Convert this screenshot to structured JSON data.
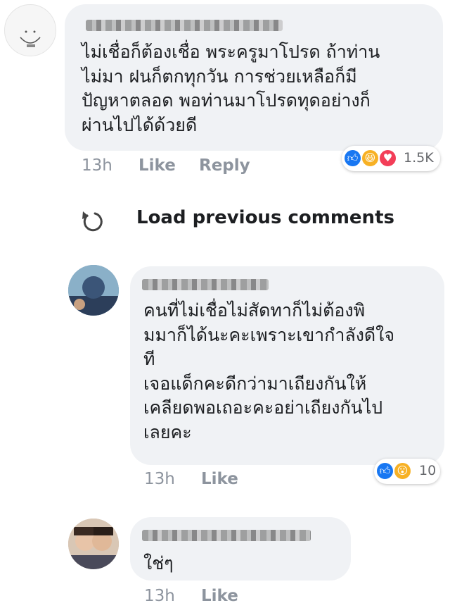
{
  "comments": [
    {
      "text_lines": [
        "ไม่เชื่อก็ต้องเชื่อ พระครูมาโปรด ถ้าท่าน",
        "ไม่มา ฝนก็ตกทุกวัน การช่วยเหลือก็มี",
        "ปัญหาตลอด พอท่านมาโปรดทุดอย่างก็",
        "ผ่านไปได้ด้วยดี"
      ],
      "time": "13h",
      "like_label": "Like",
      "reply_label": "Reply",
      "reactions": [
        "like",
        "haha",
        "love"
      ],
      "reaction_count": "1.5K"
    },
    {
      "text_lines": [
        "คนที่ไม่เชื่อไม่สัดทาก็ไม่ต้องพิ",
        "มมาก็ได้นะคะเพราะเขากำลังดีใจ",
        "ที",
        "เจอแด็กคะดีกว่ามาเถียงกันให้",
        "เคลียดพอเถอะคะอย่าเถียงกันไป",
        "เลยคะ"
      ],
      "time": "13h",
      "like_label": "Like",
      "reactions": [
        "like",
        "wow"
      ],
      "reaction_count": "10"
    },
    {
      "text_lines": [
        "ใช่ๆ"
      ],
      "time": "13h",
      "like_label": "Like"
    }
  ],
  "load_previous": {
    "label": "Load previous comments",
    "icon": "refresh-icon"
  },
  "colors": {
    "bubble": "#f0f2f5",
    "meta_text": "#8d949e",
    "like_blue": "#1877f2",
    "haha_yellow": "#f7b125",
    "love_red": "#f33e58"
  }
}
